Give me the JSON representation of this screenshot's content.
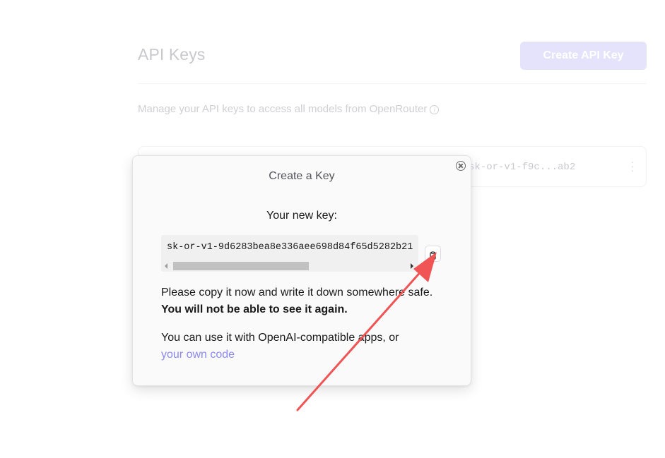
{
  "page": {
    "title": "API Keys",
    "create_button_label": "Create API Key",
    "subtitle": "Manage your API keys to access all models from OpenRouter",
    "key_row": {
      "masked_key": "sk-or-v1-f9c...ab2",
      "menu_icon": "more-vertical-icon"
    }
  },
  "modal": {
    "title": "Create a Key",
    "new_key_label": "Your new key:",
    "api_key": "sk-or-v1-9d6283bea8e336aee698d84f65d5282b21",
    "copy_icon": "clipboard-icon",
    "close_icon": "close-circle-icon",
    "warning_text": "Please copy it now and write it down somewhere safe.",
    "warning_bold": "You will not be able to see it again.",
    "usage_text": "You can use it with OpenAI-compatible apps, or",
    "usage_link": "your own code"
  },
  "colors": {
    "accent": "#8b89f0",
    "faded_button": "#e4e3fb",
    "annotation_arrow": "#f05454"
  }
}
